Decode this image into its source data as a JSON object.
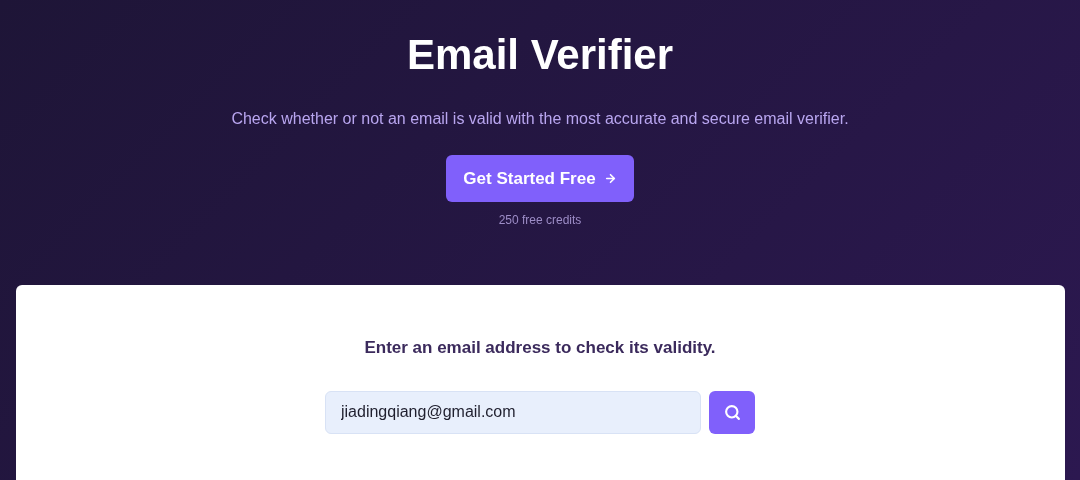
{
  "hero": {
    "title": "Email Verifier",
    "subtitle": "Check whether or not an email is valid with the most accurate and secure email verifier.",
    "cta_button": "Get Started Free",
    "cta_note": "250 free credits"
  },
  "checker": {
    "prompt": "Enter an email address to check its validity.",
    "email_field": {
      "value": "jiadingqiang@gmail.com"
    }
  }
}
